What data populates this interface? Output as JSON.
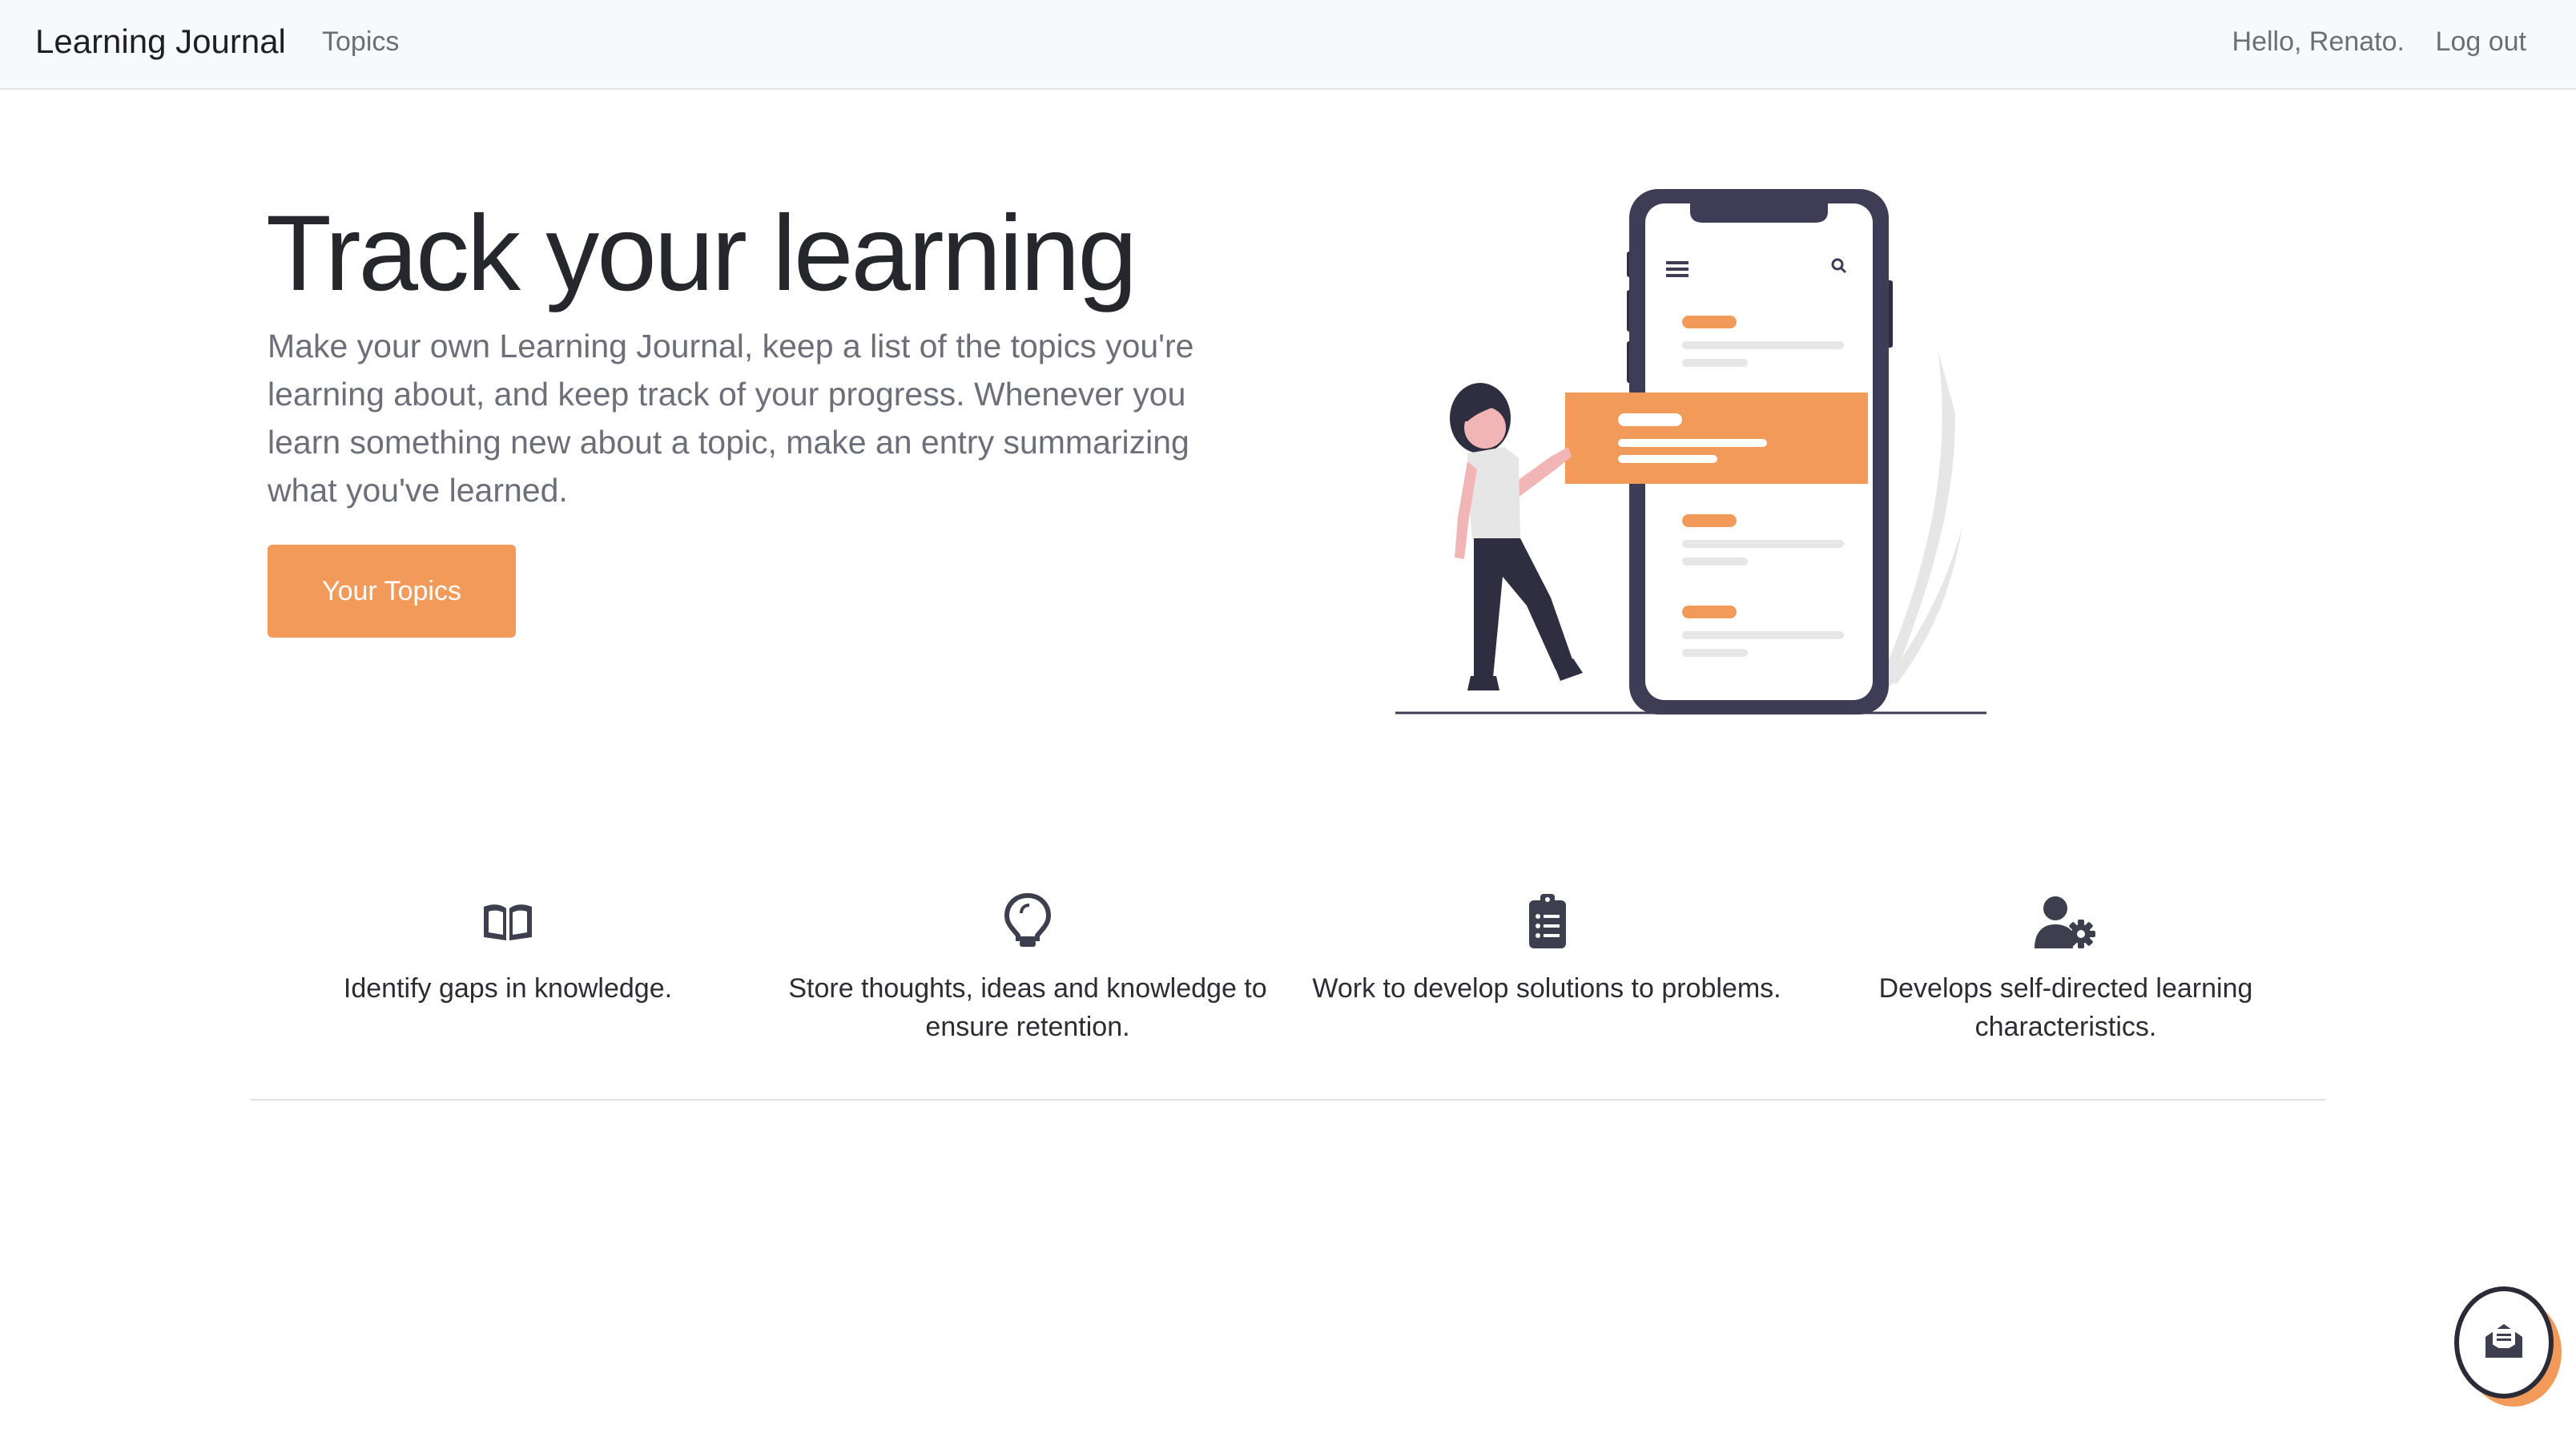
{
  "navbar": {
    "brand": "Learning Journal",
    "topics_link": "Topics",
    "greeting": "Hello, Renato.",
    "logout_link": "Log out"
  },
  "hero": {
    "title": "Track your learning",
    "description": "Make your own Learning Journal, keep a list of the topics you're learning about, and keep track of your progress. Whenever you learn something new about a topic, make an entry summarizing what you've learned.",
    "button_label": "Your Topics"
  },
  "features": [
    {
      "icon": "open-book-icon",
      "text": "Identify gaps in knowledge."
    },
    {
      "icon": "lightbulb-icon",
      "text": "Store thoughts, ideas and knowledge to ensure retention."
    },
    {
      "icon": "clipboard-list-icon",
      "text": "Work to develop solutions to problems."
    },
    {
      "icon": "user-gear-icon",
      "text": "Develops self-directed learning characteristics."
    }
  ],
  "chat_fab": {
    "icon": "envelope-open-icon"
  },
  "colors": {
    "accent": "#f19a5a",
    "dark": "#2f2e41",
    "navbar_bg": "#f8f9fa",
    "muted_text": "#6c6f78"
  }
}
